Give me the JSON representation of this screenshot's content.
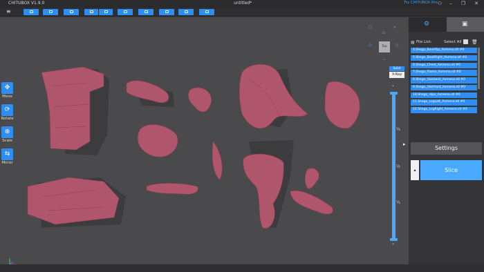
{
  "app": {
    "title": "CHITUBOX V1.9.0",
    "document_title": "untitled*",
    "pro_link": "Try CHITUBOX Pro"
  },
  "toolbar": {
    "buttons": [
      "open-file",
      "save",
      "settings",
      "undo",
      "redo",
      "repeat",
      "layout",
      "hollow",
      "support",
      "print"
    ]
  },
  "tools": [
    {
      "name": "move",
      "label": "Move",
      "icon": "✥"
    },
    {
      "name": "rotate",
      "label": "Rotate",
      "icon": "⟳"
    },
    {
      "name": "scale",
      "label": "Scale",
      "icon": "⊕"
    },
    {
      "name": "mirror",
      "label": "Mirror",
      "icon": "⇆"
    }
  ],
  "view": {
    "cube_label": "Top",
    "solid_label": "Solid",
    "xray_label": "X-Ray"
  },
  "slider": {
    "fractions": [
      "¾",
      "½",
      "¼"
    ]
  },
  "panel": {
    "file_list_label": "File List:",
    "select_all_label": "Select All",
    "files": [
      "4.Shego_BaseTop_Asmena.stl #0",
      "5.Shego_BootRight_Asmena.stl #0",
      "6.Shego_Chest_Asmena.stl #0",
      "7.Shego_Flame_Asmena.stl #0",
      "8.Shego_Hairback_Asmena.stl #0",
      "9.Shego_Hairfront_Asmena.stl #0",
      "10.Shego_Hips_Asmena.stl #0",
      "11.Shego_LegLeft_Asmena.stl #0",
      "12.Shego_LegRight_Asmena.stl #0"
    ],
    "settings_label": "Settings",
    "slice_label": "Slice"
  },
  "colors": {
    "accent": "#2f8ef2",
    "model": "#b0566c",
    "shadow": "#3a3a3c"
  }
}
